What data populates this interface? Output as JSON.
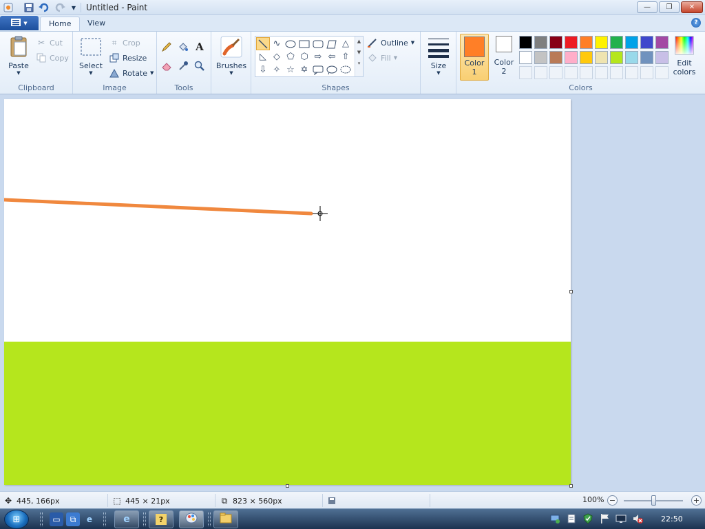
{
  "window": {
    "title": "Untitled - Paint",
    "minimize_label": "—",
    "maximize_label": "❐",
    "close_label": "✕"
  },
  "tabs": {
    "home": "Home",
    "view": "View"
  },
  "ribbon": {
    "clipboard": {
      "label": "Clipboard",
      "paste": "Paste",
      "cut": "Cut",
      "copy": "Copy"
    },
    "image": {
      "label": "Image",
      "select": "Select",
      "crop": "Crop",
      "resize": "Resize",
      "rotate": "Rotate"
    },
    "tools": {
      "label": "Tools"
    },
    "brushes": {
      "label": "Brushes"
    },
    "shapes": {
      "label": "Shapes",
      "outline": "Outline",
      "fill": "Fill"
    },
    "size": {
      "label": "Size"
    },
    "colors": {
      "label": "Colors",
      "color1": "Color",
      "color1_num": "1",
      "color2": "Color",
      "color2_num": "2",
      "edit": "Edit",
      "edit2": "colors",
      "color1_value": "#ff7f27",
      "color2_value": "#ffffff",
      "row1": [
        "#000000",
        "#7f7f7f",
        "#880015",
        "#ed1c24",
        "#ff7f27",
        "#fff200",
        "#22b14c",
        "#00a2e8",
        "#3f48cc",
        "#a349a4"
      ],
      "row2": [
        "#ffffff",
        "#c3c3c3",
        "#b97a57",
        "#ffaec9",
        "#ffc90e",
        "#efe4b0",
        "#b5e61d",
        "#99d9ea",
        "#7092be",
        "#c8bfe7"
      ]
    }
  },
  "canvas": {
    "line_color": "#f0883e",
    "grass_color": "#b5e61d"
  },
  "status": {
    "cursor_pos": "445, 166px",
    "selection_size": "445 × 21px",
    "image_size": "823 × 560px",
    "zoom": "100%"
  },
  "taskbar": {
    "clock": "22:50"
  }
}
